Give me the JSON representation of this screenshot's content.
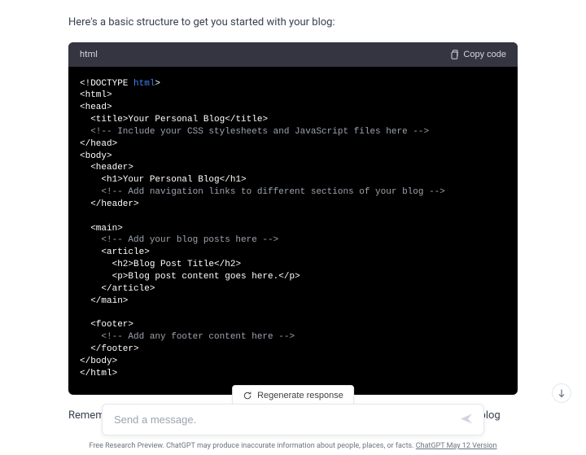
{
  "intro": "Here's a basic structure to get you started with your blog:",
  "code": {
    "lang": "html",
    "copy_label": "Copy code",
    "lines": {
      "l0a": "<!DOCTYPE ",
      "l0b": "html",
      "l0c": ">",
      "l1": "<html>",
      "l2": "<head>",
      "l3a": "  <title>",
      "l3b": "Your Personal Blog",
      "l3c": "</title>",
      "l4": "  <!-- Include your CSS stylesheets and JavaScript files here -->",
      "l5": "</head>",
      "l6": "<body>",
      "l7": "  <header>",
      "l8a": "    <h1>",
      "l8b": "Your Personal Blog",
      "l8c": "</h1>",
      "l9": "    <!-- Add navigation links to different sections of your blog -->",
      "l10": "  </header>",
      "l12": "  <main>",
      "l13": "    <!-- Add your blog posts here -->",
      "l14": "    <article>",
      "l15a": "      <h2>",
      "l15b": "Blog Post Title",
      "l15c": "</h2>",
      "l16a": "      <p>",
      "l16b": "Blog post content goes here.",
      "l16c": "</p>",
      "l17": "    </article>",
      "l18": "  </main>",
      "l20": "  <footer>",
      "l21": "    <!-- Add any footer content here -->",
      "l22": "  </footer>",
      "l23": "</body>",
      "l24": "</html>"
    }
  },
  "after_a": "Remember, this is a simplified stru",
  "after_b": "ed. As you develop your blog",
  "regen_label": "Regenerate response",
  "input_placeholder": "Send a message.",
  "footer": {
    "text": "Free Research Preview. ChatGPT may produce inaccurate information about people, places, or facts. ",
    "link": "ChatGPT May 12 Version"
  }
}
